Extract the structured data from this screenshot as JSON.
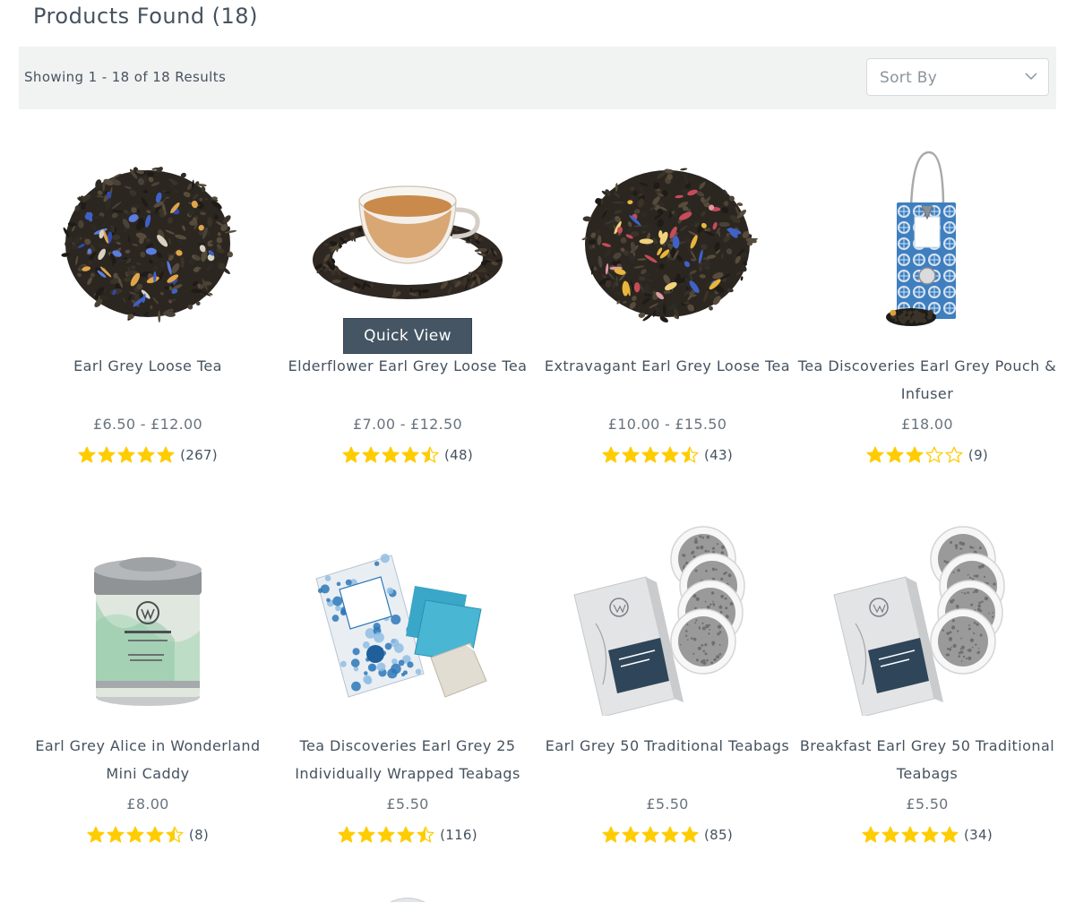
{
  "header": {
    "title": "Products Found (18)"
  },
  "results": {
    "count_text": "Showing 1 - 18 of 18 Results"
  },
  "sort": {
    "label": "Sort By"
  },
  "quick_view_label": "Quick View",
  "colors": {
    "star": "#ffcc00",
    "bar_bg": "#f1f2f2",
    "button_bg": "#455564",
    "text": "#45525f"
  },
  "products": [
    {
      "name": "Earl Grey Loose Tea",
      "price": "£6.50 - £12.00",
      "rating": 5,
      "count": "(267)",
      "image": "loose-tea-blue-petals"
    },
    {
      "name": "Elderflower Earl Grey Loose Tea",
      "price": "£7.00 - £12.50",
      "rating": 4.5,
      "count": "(48)",
      "image": "tea-cup-with-leaves"
    },
    {
      "name": "Extravagant Earl Grey Loose Tea",
      "price": "£10.00 - £15.50",
      "rating": 4.5,
      "count": "(43)",
      "image": "loose-tea-rose-petals"
    },
    {
      "name": "Tea Discoveries Earl Grey Pouch & Infuser",
      "price": "£18.00",
      "rating": 3,
      "count": "(9)",
      "image": "blue-gift-pouch"
    },
    {
      "name": "Earl Grey Alice in Wonderland Mini Caddy",
      "price": "£8.00",
      "rating": 4.5,
      "count": "(8)",
      "image": "tea-caddy-tin"
    },
    {
      "name": "Tea Discoveries Earl Grey 25 Individually Wrapped Teabags",
      "price": "£5.50",
      "rating": 4.5,
      "count": "(116)",
      "image": "blue-teabag-box"
    },
    {
      "name": "Earl Grey 50 Traditional Teabags",
      "price": "£5.50",
      "rating": 5,
      "count": "(85)",
      "image": "grey-teabag-box"
    },
    {
      "name": "Breakfast Earl Grey 50 Traditional Teabags",
      "price": "£5.50",
      "rating": 5,
      "count": "(34)",
      "image": "grey-teabag-box"
    }
  ]
}
